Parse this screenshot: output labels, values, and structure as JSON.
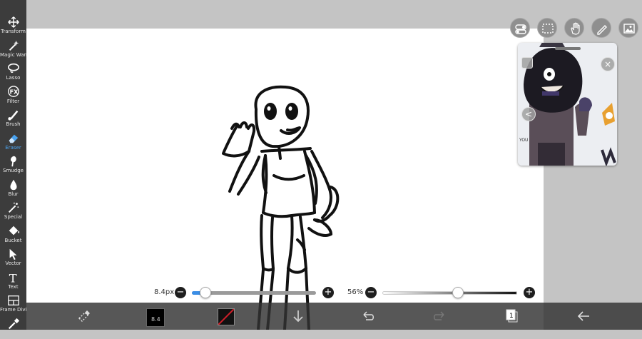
{
  "toolbar": {
    "items": [
      {
        "label": "Transform",
        "icon": "move-icon",
        "active": false
      },
      {
        "label": "Magic Wand",
        "icon": "magic-wand-icon",
        "active": false
      },
      {
        "label": "Lasso",
        "icon": "lasso-icon",
        "active": false
      },
      {
        "label": "Filter",
        "icon": "fx-icon",
        "active": false,
        "glyph": "FX"
      },
      {
        "label": "Brush",
        "icon": "brush-icon",
        "active": false
      },
      {
        "label": "Eraser",
        "icon": "eraser-icon",
        "active": true
      },
      {
        "label": "Smudge",
        "icon": "smudge-icon",
        "active": false
      },
      {
        "label": "Blur",
        "icon": "blur-drop-icon",
        "active": false
      },
      {
        "label": "Special",
        "icon": "special-wand-icon",
        "active": false
      },
      {
        "label": "Bucket",
        "icon": "bucket-icon",
        "active": false
      },
      {
        "label": "Vector",
        "icon": "vector-arrow-icon",
        "active": false
      },
      {
        "label": "Text",
        "icon": "text-icon",
        "active": false,
        "glyph": "T"
      },
      {
        "label": "Frame Divider",
        "icon": "frame-divider-icon",
        "active": false
      },
      {
        "label": "",
        "icon": "eyedropper-icon",
        "active": false
      }
    ]
  },
  "top_icons": [
    {
      "name": "toggle-icon"
    },
    {
      "name": "selection-icon"
    },
    {
      "name": "hand-icon"
    },
    {
      "name": "pen-icon"
    },
    {
      "name": "image-icon"
    }
  ],
  "reference_window": {
    "close_glyph": "×",
    "back_glyph": "<",
    "side_text": "YOU"
  },
  "sliders": {
    "brush_size": {
      "label": "8.4px",
      "minus": "−",
      "plus": "+",
      "value": 0.11
    },
    "opacity": {
      "label": "56%",
      "minus": "−",
      "plus": "+",
      "value": 0.56
    }
  },
  "bottom_bar": {
    "brush_preview_label": "8.4",
    "colors": {
      "accent": "#4aa3f0",
      "color_swatch_primary": "#d11f2a"
    }
  }
}
